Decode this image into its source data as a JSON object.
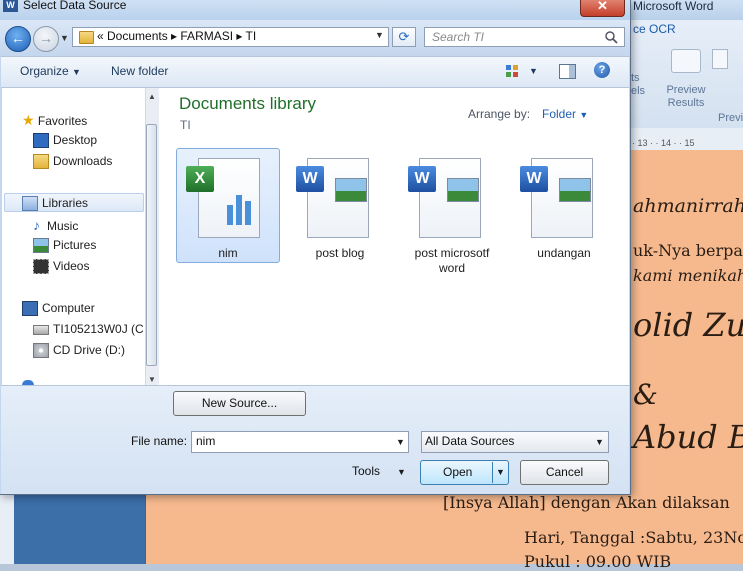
{
  "dialog": {
    "title": "Select Data Source",
    "close_label": "✕"
  },
  "navbar": {
    "breadcrumb": "«  Documents  ▸  FARMASI  ▸  TI",
    "search_placeholder": "Search TI"
  },
  "toolbar": {
    "organize_label": "Organize",
    "new_folder_label": "New folder"
  },
  "nav_pane": {
    "items": [
      {
        "label": "Favorites",
        "icon": "star-icon"
      },
      {
        "label": "Desktop",
        "icon": "desktop-icon"
      },
      {
        "label": "Downloads",
        "icon": "downloads-folder-icon"
      },
      {
        "label": "Libraries",
        "icon": "libraries-icon"
      },
      {
        "label": "Music",
        "icon": "music-icon"
      },
      {
        "label": "Pictures",
        "icon": "pictures-icon"
      },
      {
        "label": "Videos",
        "icon": "videos-icon"
      },
      {
        "label": "Computer",
        "icon": "computer-icon"
      },
      {
        "label": "TI105213W0J  (C:",
        "icon": "hard-drive-icon"
      },
      {
        "label": "CD Drive (D:)",
        "icon": "cd-drive-icon"
      }
    ]
  },
  "content": {
    "library_title": "Documents library",
    "library_subtitle": "TI",
    "arrange_label": "Arrange by:",
    "arrange_value": "Folder",
    "files": [
      {
        "name": "nim",
        "type": "excel"
      },
      {
        "name": "post blog",
        "type": "word"
      },
      {
        "name": "post microsotf word",
        "type": "word"
      },
      {
        "name": "undangan",
        "type": "word"
      }
    ]
  },
  "bottom": {
    "new_source_label": "New Source...",
    "filename_label": "File name:",
    "filename_value": "nim",
    "filter_value": "All Data Sources",
    "tools_label": "Tools",
    "open_label": "Open",
    "cancel_label": "Cancel"
  },
  "word_bg": {
    "title": "Microsoft Word",
    "ribbon_tab": "ce OCR",
    "preview_label": "Preview Results",
    "group_label": "Previ",
    "left_labels": "ts els",
    "ruler_marks": "· 13 · · 14 · · 15",
    "doc_lines": [
      "ahmanirrah",
      "uk-Nya berpa",
      "kami menikahk",
      "olid Zul",
      "&",
      "Abud Ba",
      "[Insya Allah] dengan Akan dilaksan",
      "Hari, Tanggal :Sabtu, 23Nov",
      "Pukul : 09.00 WIB"
    ]
  }
}
